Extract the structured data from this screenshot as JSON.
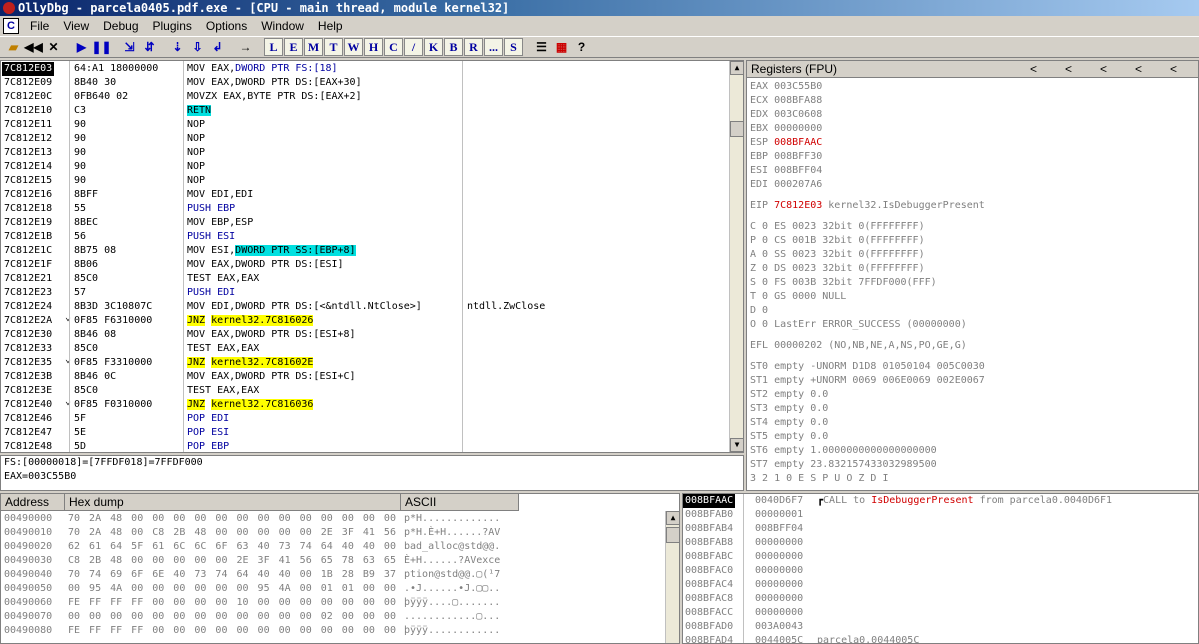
{
  "window": {
    "title": "OllyDbg - parcela0405.pdf.exe - [CPU - main thread, module kernel32]"
  },
  "menu": {
    "mdi_icon": "C",
    "items": [
      "File",
      "View",
      "Debug",
      "Plugins",
      "Options",
      "Window",
      "Help"
    ]
  },
  "toolbar": {
    "letters": [
      "L",
      "E",
      "M",
      "T",
      "W",
      "H",
      "C",
      "/",
      "K",
      "B",
      "R",
      "...",
      "S"
    ]
  },
  "disasm": {
    "rows": [
      {
        "a": "7C812E03",
        "h": "64:A1 18000000",
        "m": "MOV EAX,",
        "x": "DWORD PTR FS:[18]",
        "sel": true
      },
      {
        "a": "7C812E09",
        "h": "8B40 30",
        "m": "MOV EAX,DWORD PTR DS:[EAX+30]"
      },
      {
        "a": "7C812E0C",
        "h": "0FB640 02",
        "m": "MOVZX EAX,BYTE PTR DS:[EAX+2]"
      },
      {
        "a": "7C812E10",
        "h": "C3",
        "m": "",
        "x": "RETN",
        "cyan": true
      },
      {
        "a": "7C812E11",
        "h": "90",
        "m": "NOP"
      },
      {
        "a": "7C812E12",
        "h": "90",
        "m": "NOP"
      },
      {
        "a": "7C812E13",
        "h": "90",
        "m": "NOP"
      },
      {
        "a": "7C812E14",
        "h": "90",
        "m": "NOP"
      },
      {
        "a": "7C812E15",
        "h": "90",
        "m": "NOP"
      },
      {
        "a": "7C812E16",
        "h": "8BFF",
        "m": "MOV EDI,EDI"
      },
      {
        "a": "7C812E18",
        "h": "55",
        "m": "PUSH EBP"
      },
      {
        "a": "7C812E19",
        "h": "8BEC",
        "m": "MOV EBP,ESP"
      },
      {
        "a": "7C812E1B",
        "h": "56",
        "m": "PUSH ESI"
      },
      {
        "a": "7C812E1C",
        "h": "8B75 08",
        "m": "MOV ESI,",
        "x": "DWORD PTR SS:[EBP+8]",
        "cyan": true
      },
      {
        "a": "7C812E1F",
        "h": "8B06",
        "m": "MOV EAX,DWORD PTR DS:[ESI]"
      },
      {
        "a": "7C812E21",
        "h": "85C0",
        "m": "TEST EAX,EAX"
      },
      {
        "a": "7C812E23",
        "h": "57",
        "m": "PUSH EDI"
      },
      {
        "a": "7C812E24",
        "h": "8B3D 3C10807C",
        "m": "MOV EDI,DWORD PTR DS:[<&ntdll.NtClose>]",
        "c": "ntdll.ZwClose",
        "ul": true
      },
      {
        "a": "7C812E2A",
        "h": "0F85 F6310000",
        "m": "",
        "x": "JNZ",
        "y": "kernel32.7C816026",
        "yel": true,
        "arr": true
      },
      {
        "a": "7C812E30",
        "h": "8B46 08",
        "m": "MOV EAX,DWORD PTR DS:[ESI+8]"
      },
      {
        "a": "7C812E33",
        "h": "85C0",
        "m": "TEST EAX,EAX"
      },
      {
        "a": "7C812E35",
        "h": "0F85 F3310000",
        "m": "",
        "x": "JNZ",
        "y": "kernel32.7C81602E",
        "yel": true,
        "arr": true
      },
      {
        "a": "7C812E3B",
        "h": "8B46 0C",
        "m": "MOV EAX,DWORD PTR DS:[ESI+C]"
      },
      {
        "a": "7C812E3E",
        "h": "85C0",
        "m": "TEST EAX,EAX"
      },
      {
        "a": "7C812E40",
        "h": "0F85 F0310000",
        "m": "",
        "x": "JNZ",
        "y": "kernel32.7C816036",
        "yel": true,
        "arr": true
      },
      {
        "a": "7C812E46",
        "h": "5F",
        "m": "POP EDI"
      },
      {
        "a": "7C812E47",
        "h": "5E",
        "m": "POP ESI"
      },
      {
        "a": "7C812E48",
        "h": "5D",
        "m": "POP EBP"
      }
    ]
  },
  "info": {
    "line1": "FS:[00000018]=[7FFDF018]=7FFDF000",
    "line2": "EAX=003C55B0"
  },
  "registers": {
    "header": "Registers (FPU)",
    "arrows": [
      "<",
      "<",
      "<",
      "<",
      "<"
    ],
    "lines": [
      {
        "t": "EAX 003C55B0",
        "g": true
      },
      {
        "t": "ECX 008BFA88",
        "g": true
      },
      {
        "t": "EDX 003C0608",
        "g": true
      },
      {
        "t": "EBX 00000000",
        "g": true
      },
      {
        "t": "ESP ",
        "r": "008BFAAC"
      },
      {
        "t": "EBP 008BFF30",
        "g": true
      },
      {
        "t": "ESI 008BFF04",
        "g": true
      },
      {
        "t": "EDI 000207A6",
        "g": true
      },
      {
        "t": "",
        "gap": true
      },
      {
        "t": "EIP ",
        "r": "7C812E03",
        "s": " kernel32.IsDebuggerPresent"
      },
      {
        "t": "",
        "gap": true
      },
      {
        "t": "C 0  ES 0023 32bit 0(FFFFFFFF)",
        "g": true
      },
      {
        "t": "P 0  CS 001B 32bit 0(FFFFFFFF)",
        "g": true
      },
      {
        "t": "A 0  SS 0023 32bit 0(FFFFFFFF)",
        "g": true
      },
      {
        "t": "Z 0  DS 0023 32bit 0(FFFFFFFF)",
        "g": true
      },
      {
        "t": "S 0  FS 003B 32bit 7FFDF000(FFF)",
        "g": true
      },
      {
        "t": "T 0  GS 0000 NULL",
        "g": true
      },
      {
        "t": "D 0",
        "g": true
      },
      {
        "t": "O 0  LastErr ERROR_SUCCESS (00000000)",
        "g": true
      },
      {
        "t": "",
        "gap": true
      },
      {
        "t": "EFL 00000202 (NO,NB,NE,A,NS,PO,GE,G)",
        "g": true
      },
      {
        "t": "",
        "gap": true
      },
      {
        "t": "ST0 empty -UNORM D1D8 01050104 005C0030",
        "g": true
      },
      {
        "t": "ST1 empty +UNORM 0069 006E0069 002E0067",
        "g": true
      },
      {
        "t": "ST2 empty 0.0",
        "g": true
      },
      {
        "t": "ST3 empty 0.0",
        "g": true
      },
      {
        "t": "ST4 empty 0.0",
        "g": true
      },
      {
        "t": "ST5 empty 0.0",
        "g": true
      },
      {
        "t": "ST6 empty 1.0000000000000000000",
        "g": true
      },
      {
        "t": "ST7 empty 23.832157433032989500",
        "g": true
      },
      {
        "t": "               3 2 1 0      E S P U O Z D I",
        "g": true
      }
    ]
  },
  "dump": {
    "headers": [
      "Address",
      "Hex dump",
      "ASCII"
    ],
    "rows": [
      {
        "a": "00490000",
        "h": "70 2A 48 00 00 00 00 00 00 00 00 00 00 00 00 00",
        "s": "p*H............."
      },
      {
        "a": "00490010",
        "h": "70 2A 48 00 C8 2B 48 00 00 00 00 00 2E 3F 41 56",
        "s": "p*H.È+H......?AV"
      },
      {
        "a": "00490020",
        "h": "62 61 64 5F 61 6C 6C 6F 63 40 73 74 64 40 40 00",
        "s": "bad_alloc@std@@."
      },
      {
        "a": "00490030",
        "h": "C8 2B 48 00 00 00 00 00 2E 3F 41 56 65 78 63 65",
        "s": "È+H......?AVexce"
      },
      {
        "a": "00490040",
        "h": "70 74 69 6F 6E 40 73 74 64 40 40 00 1B 28 B9 37",
        "s": "ption@std@@.▢(¹7"
      },
      {
        "a": "00490050",
        "h": "00 95 4A 00 00 00 00 00 00 95 4A 00 01 01 00 00",
        "s": ".•J......•J.▢▢.."
      },
      {
        "a": "00490060",
        "h": "FE FF FF FF 00 00 00 00 10 00 00 00 00 00 00 00",
        "s": "þÿÿÿ....▢......."
      },
      {
        "a": "00490070",
        "h": "00 00 00 00 00 00 00 00 00 00 00 00 02 00 00 00",
        "s": "............▢..."
      },
      {
        "a": "00490080",
        "h": "FE FF FF FF 00 00 00 00 00 00 00 00 00 00 00 00",
        "s": "þÿÿÿ............"
      }
    ]
  },
  "stack": {
    "rows": [
      {
        "a": "008BFAAC",
        "v": "0040D6F7",
        "c1": "CALL to ",
        "c2": "IsDebuggerPresent",
        "c3": " from parcela0.0040D6F1",
        "sel": true
      },
      {
        "a": "008BFAB0",
        "v": "00000001"
      },
      {
        "a": "008BFAB4",
        "v": "008BFF04"
      },
      {
        "a": "008BFAB8",
        "v": "00000000"
      },
      {
        "a": "008BFABC",
        "v": "00000000"
      },
      {
        "a": "008BFAC0",
        "v": "00000000"
      },
      {
        "a": "008BFAC4",
        "v": "00000000"
      },
      {
        "a": "008BFAC8",
        "v": "00000000"
      },
      {
        "a": "008BFACC",
        "v": "00000000"
      },
      {
        "a": "008BFAD0",
        "v": "003A0043"
      },
      {
        "a": "008BFAD4",
        "v": "0044005C",
        "c1": "parcela0.0044005C"
      }
    ]
  }
}
